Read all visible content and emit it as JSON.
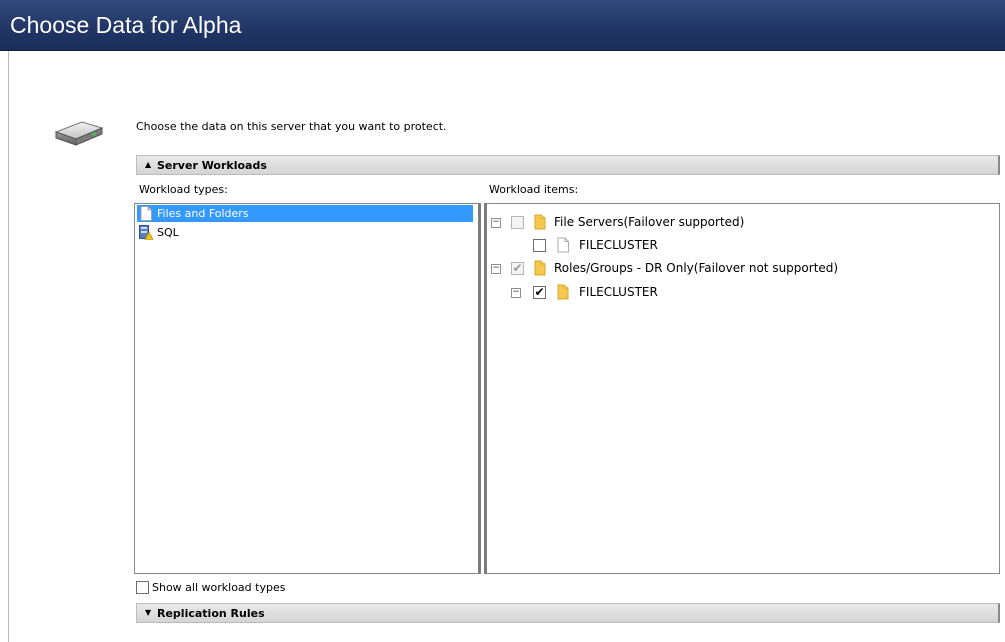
{
  "window": {
    "title": "Choose Data for Alpha"
  },
  "intro_text": "Choose the data on this server that you want to protect.",
  "sections": {
    "server_workloads": {
      "label": "Server Workloads",
      "caret": "▲"
    },
    "replication_rules": {
      "label": "Replication Rules",
      "caret": "▼"
    }
  },
  "workload_types": {
    "label": "Workload types:",
    "items": [
      {
        "label": "Files and Folders",
        "icon": "document-icon",
        "selected": true
      },
      {
        "label": "SQL",
        "icon": "sql-database-icon",
        "selected": false
      }
    ]
  },
  "workload_items": {
    "label": "Workload items:",
    "tree": [
      {
        "label": "File Servers(Failover supported)",
        "icon": "folder-icon",
        "expander": "−",
        "checked": false,
        "disabled": true
      },
      {
        "label": "FILECLUSTER",
        "icon": "document-icon",
        "checked": false,
        "disabled": false
      },
      {
        "label": "Roles/Groups - DR Only(Failover not supported)",
        "icon": "folder-icon",
        "expander": "−",
        "checked": true,
        "disabled": true,
        "check_mark": "✔"
      },
      {
        "label": "FILECLUSTER",
        "icon": "folder-icon",
        "expander": "−",
        "checked": true,
        "disabled": false,
        "check_mark": "✔"
      }
    ]
  },
  "show_all_types": {
    "label": "Show all workload types",
    "checked": false
  },
  "colors": {
    "title_bar": "#223767",
    "selection": "#3399ff",
    "folder": "#f5c950"
  }
}
